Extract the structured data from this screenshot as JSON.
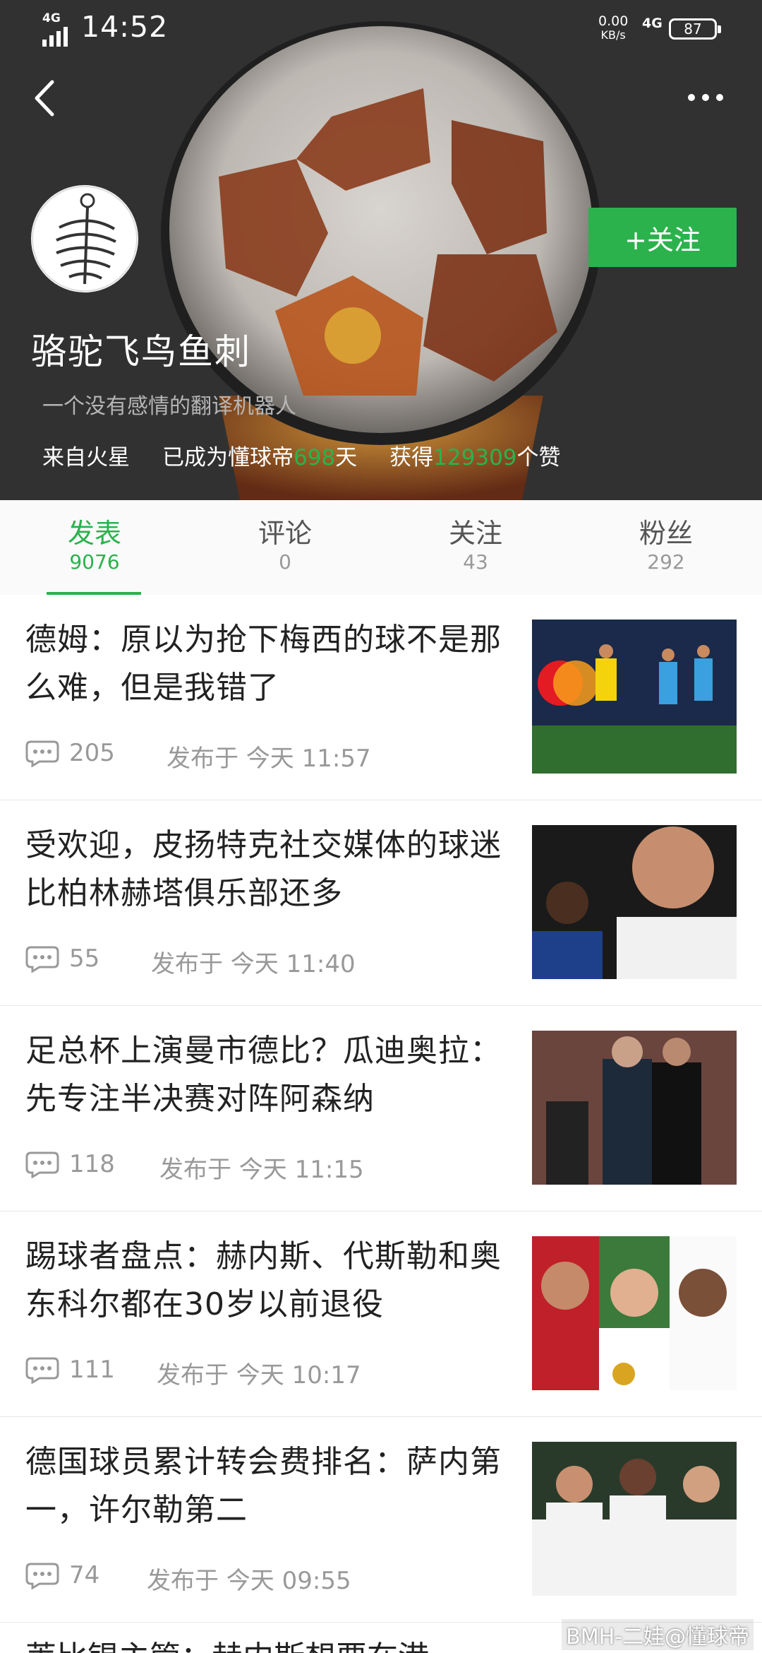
{
  "status_bar": {
    "network": "4G",
    "time": "14:52",
    "speed_value": "0.00",
    "speed_unit": "KB/s",
    "net_type": "4G",
    "battery": "87"
  },
  "profile": {
    "username": "骆驼飞鸟鱼刺",
    "bio": "一个没有感情的翻译机器人",
    "location": "来自火星",
    "days_prefix": "已成为懂球帝",
    "days_value": "698",
    "days_suffix": "天",
    "likes_prefix": "获得",
    "likes_value": "129309",
    "likes_suffix": "个赞",
    "follow_label": "+关注"
  },
  "tabs": [
    {
      "label": "发表",
      "count": "9076"
    },
    {
      "label": "评论",
      "count": "0"
    },
    {
      "label": "关注",
      "count": "43"
    },
    {
      "label": "粉丝",
      "count": "292"
    }
  ],
  "articles": [
    {
      "title": "德姆：原以为抢下梅西的球不是那么难，但是我错了",
      "comments": "205",
      "published": "发布于 今天 11:57"
    },
    {
      "title": "受欢迎，皮扬特克社交媒体的球迷比柏林赫塔俱乐部还多",
      "comments": "55",
      "published": "发布于 今天 11:40"
    },
    {
      "title": "足总杯上演曼市德比？瓜迪奥拉：先专注半决赛对阵阿森纳",
      "comments": "118",
      "published": "发布于 今天 11:15"
    },
    {
      "title": "踢球者盘点：赫内斯、代斯勒和奥东科尔都在30岁以前退役",
      "comments": "111",
      "published": "发布于 今天 10:17"
    },
    {
      "title": "德国球员累计转会费排名：萨内第一，许尔勒第二",
      "comments": "74",
      "published": "发布于 今天 09:55"
    }
  ],
  "partial_article_title": "莱比锡主管：赫内斯想要在港",
  "watermark": "BMH-二娃@懂球帝",
  "colors": {
    "accent": "#2bb24c",
    "header_bg": "#2b2b2b"
  }
}
